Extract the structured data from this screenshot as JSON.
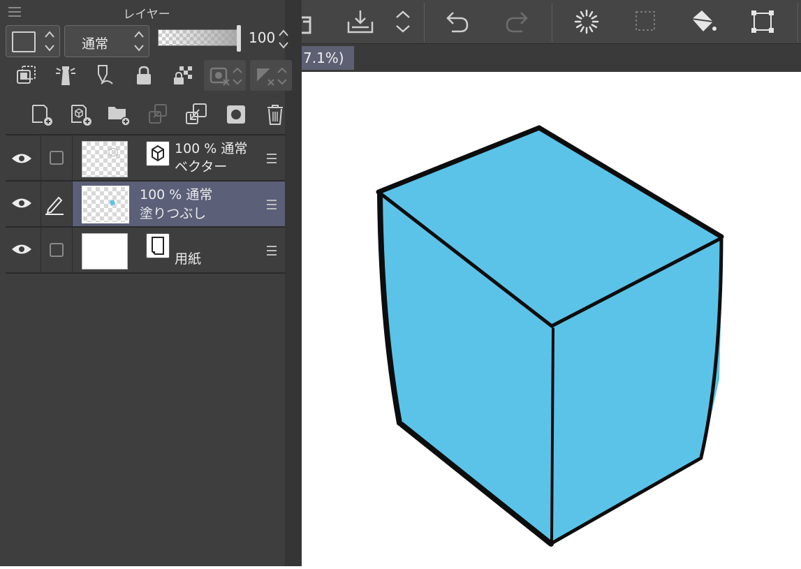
{
  "panel": {
    "title": "レイヤー",
    "blend_mode": "通常",
    "opacity_value": "100"
  },
  "layers": [
    {
      "percent_mode": "100 % 通常",
      "name": "ベクター",
      "type": "vector",
      "visible": true,
      "selected": false
    },
    {
      "percent_mode": "100 % 通常",
      "name": "塗りつぶし",
      "type": "raster",
      "visible": true,
      "selected": true
    },
    {
      "percent_mode": "",
      "name": "用紙",
      "type": "paper",
      "visible": true,
      "selected": false
    }
  ],
  "canvas": {
    "zoom_tab_label": "7.1%)",
    "fill_color": "#5bc3e8",
    "stroke_color": "#0d0d0d"
  },
  "colors": {
    "panel_bg": "#3e3e3e",
    "selected_row": "#5b5f78",
    "toolbar_bg": "#454545"
  },
  "toolbar": {
    "icons": [
      "save-to-device-icon",
      "export-icon",
      "updown-icon",
      "undo-icon",
      "redo-icon",
      "loading-icon",
      "selection-icon",
      "fill-bucket-icon",
      "transform-icon"
    ]
  }
}
